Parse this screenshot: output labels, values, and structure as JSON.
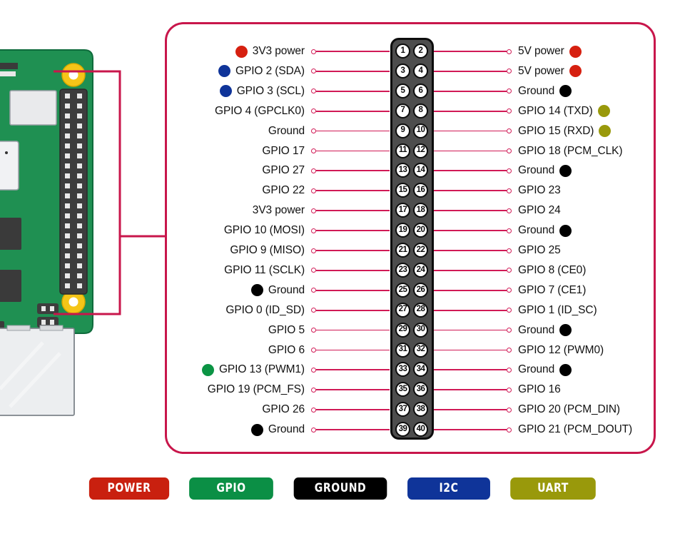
{
  "title": "Raspberry Pi 40-pin GPIO header pinout",
  "colors": {
    "power": "#d62010",
    "gpio": "#0b9444",
    "ground": "#000000",
    "i2c": "#0f3499",
    "uart": "#99990b",
    "accent_line": "#d11a56",
    "panel_border": "#c8164b",
    "block_body": "#4d4d4d",
    "block_outline": "#0c0c0c",
    "board_green": "#1f9052"
  },
  "legend": [
    {
      "key": "POWER",
      "label": "POWER",
      "color": "#c9200f"
    },
    {
      "key": "GPIO",
      "label": "GPIO",
      "color": "#0b8f45"
    },
    {
      "key": "GROUND",
      "label": "GROUND",
      "color": "#000000"
    },
    {
      "key": "I2C",
      "label": "I2C",
      "color": "#0f3499"
    },
    {
      "key": "UART",
      "label": "UART",
      "color": "#99990b"
    }
  ],
  "pins": [
    {
      "num": 1,
      "label": "3V3 power",
      "dot": "#d62010",
      "side": "left"
    },
    {
      "num": 2,
      "label": "5V power",
      "dot": "#d62010",
      "side": "right"
    },
    {
      "num": 3,
      "label": "GPIO 2 (SDA)",
      "dot": "#0f3499",
      "side": "left"
    },
    {
      "num": 4,
      "label": "5V power",
      "dot": "#d62010",
      "side": "right"
    },
    {
      "num": 5,
      "label": "GPIO 3 (SCL)",
      "dot": "#0f3499",
      "side": "left"
    },
    {
      "num": 6,
      "label": "Ground",
      "dot": "#000000",
      "side": "right"
    },
    {
      "num": 7,
      "label": "GPIO 4 (GPCLK0)",
      "dot": null,
      "side": "left"
    },
    {
      "num": 8,
      "label": "GPIO 14 (TXD)",
      "dot": "#99990b",
      "side": "right"
    },
    {
      "num": 9,
      "label": "Ground",
      "dot": null,
      "side": "left"
    },
    {
      "num": 10,
      "label": "GPIO 15 (RXD)",
      "dot": "#99990b",
      "side": "right"
    },
    {
      "num": 11,
      "label": "GPIO 17",
      "dot": null,
      "side": "left"
    },
    {
      "num": 12,
      "label": "GPIO 18 (PCM_CLK)",
      "dot": null,
      "side": "right"
    },
    {
      "num": 13,
      "label": "GPIO 27",
      "dot": null,
      "side": "left"
    },
    {
      "num": 14,
      "label": "Ground",
      "dot": "#000000",
      "side": "right"
    },
    {
      "num": 15,
      "label": "GPIO 22",
      "dot": null,
      "side": "left"
    },
    {
      "num": 16,
      "label": "GPIO 23",
      "dot": null,
      "side": "right"
    },
    {
      "num": 17,
      "label": "3V3 power",
      "dot": null,
      "side": "left"
    },
    {
      "num": 18,
      "label": "GPIO 24",
      "dot": null,
      "side": "right"
    },
    {
      "num": 19,
      "label": "GPIO 10 (MOSI)",
      "dot": null,
      "side": "left"
    },
    {
      "num": 20,
      "label": "Ground",
      "dot": "#000000",
      "side": "right"
    },
    {
      "num": 21,
      "label": "GPIO 9 (MISO)",
      "dot": null,
      "side": "left"
    },
    {
      "num": 22,
      "label": "GPIO 25",
      "dot": null,
      "side": "right"
    },
    {
      "num": 23,
      "label": "GPIO 11 (SCLK)",
      "dot": null,
      "side": "left"
    },
    {
      "num": 24,
      "label": "GPIO 8 (CE0)",
      "dot": null,
      "side": "right"
    },
    {
      "num": 25,
      "label": "Ground",
      "dot": "#000000",
      "side": "left"
    },
    {
      "num": 26,
      "label": "GPIO 7 (CE1)",
      "dot": null,
      "side": "right"
    },
    {
      "num": 27,
      "label": "GPIO 0 (ID_SD)",
      "dot": null,
      "side": "left"
    },
    {
      "num": 28,
      "label": "GPIO 1 (ID_SC)",
      "dot": null,
      "side": "right"
    },
    {
      "num": 29,
      "label": "GPIO 5",
      "dot": null,
      "side": "left"
    },
    {
      "num": 30,
      "label": "Ground",
      "dot": "#000000",
      "side": "right"
    },
    {
      "num": 31,
      "label": "GPIO 6",
      "dot": null,
      "side": "left"
    },
    {
      "num": 32,
      "label": "GPIO 12 (PWM0)",
      "dot": null,
      "side": "right"
    },
    {
      "num": 33,
      "label": "GPIO 13 (PWM1)",
      "dot": "#0b9444",
      "side": "left"
    },
    {
      "num": 34,
      "label": "Ground",
      "dot": "#000000",
      "side": "right"
    },
    {
      "num": 35,
      "label": "GPIO 19 (PCM_FS)",
      "dot": null,
      "side": "left"
    },
    {
      "num": 36,
      "label": "GPIO 16",
      "dot": null,
      "side": "right"
    },
    {
      "num": 37,
      "label": "GPIO 26",
      "dot": null,
      "side": "left"
    },
    {
      "num": 38,
      "label": "GPIO 20 (PCM_DIN)",
      "dot": null,
      "side": "right"
    },
    {
      "num": 39,
      "label": "Ground",
      "dot": "#000000",
      "side": "left"
    },
    {
      "num": 40,
      "label": "GPIO 21 (PCM_DOUT)",
      "dot": null,
      "side": "right"
    }
  ]
}
